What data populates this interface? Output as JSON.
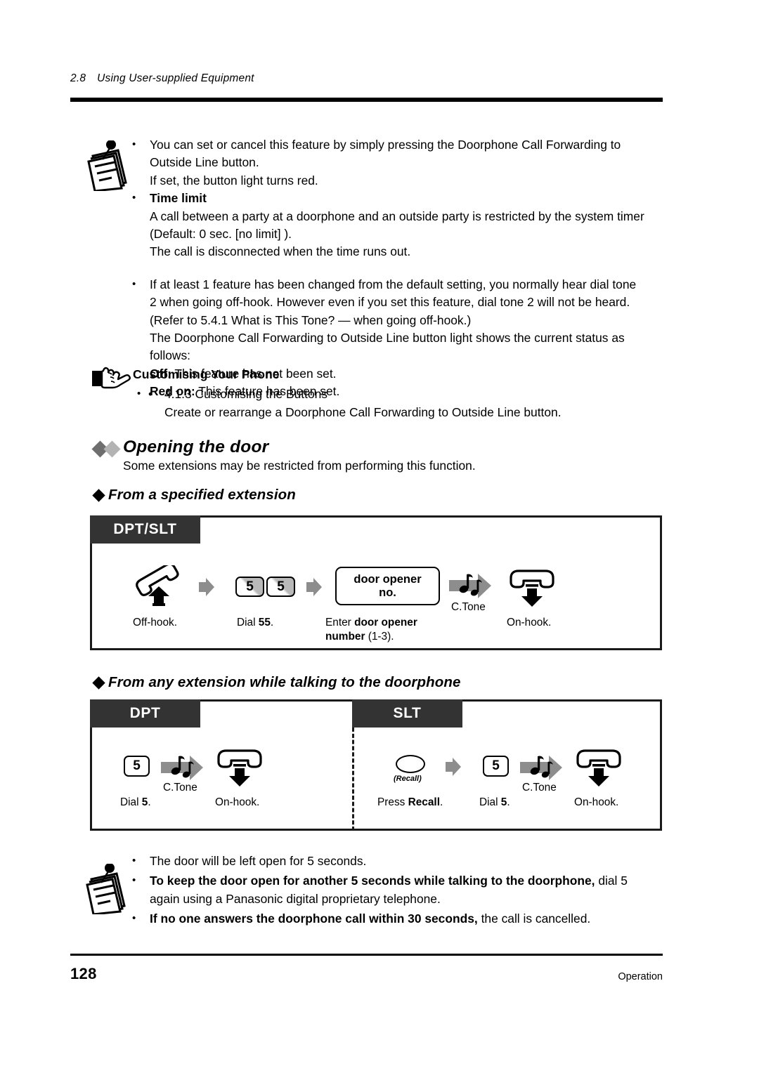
{
  "header": {
    "section_number": "2.8",
    "section_title": "Using User-supplied Equipment"
  },
  "note_block_top": {
    "icon": "note-pad-icon",
    "items": [
      {
        "bullet": true,
        "lines": [
          "You can set or cancel this feature by simply pressing the Doorphone Call Forwarding to",
          "Outside Line button.",
          "If set, the button light turns red."
        ]
      },
      {
        "bullet": true,
        "bold_lead": "Time limit",
        "lines": [
          "A call between a party at a doorphone and an outside party is restricted by the system timer",
          "(Default: 0 sec. [no limit] ).",
          "The call is disconnected when the time runs out."
        ]
      },
      {
        "bullet": true,
        "lines": [
          "If at least 1 feature has been changed from the default setting, you normally hear dial tone",
          "2 when going off-hook. However even if you set this feature, dial tone 2 will not be heard.",
          "(Refer to 5.4.1    What is This Tone? — when going off-hook.)",
          "The Doorphone Call Forwarding to Outside Line button light shows the current status as",
          "follows:"
        ],
        "status_lines": [
          {
            "bold": "Off:",
            "rest": " This feature has not been set."
          },
          {
            "bold": "Red on:",
            "rest": " This feature has been set."
          }
        ]
      }
    ]
  },
  "customising_block": {
    "icon": "pointing-hand-icon",
    "title": "Customising Your Phone",
    "items": [
      {
        "bullet": true,
        "text": "4.1.3    Customising the Buttons"
      },
      {
        "bullet": false,
        "text": "Create or rearrange a Doorphone Call Forwarding to Outside Line button."
      }
    ]
  },
  "opening_the_door": {
    "heading": "Opening the door",
    "diamond_color_1": "#6e6e6e",
    "diamond_color_2": "#b3b3b3",
    "intro": "Some extensions may be restricted from performing this function."
  },
  "subsection_1": {
    "heading": "From a specified extension",
    "diagram": {
      "tab_label": "DPT/SLT",
      "steps": [
        {
          "icon": "handset-off-hook-icon",
          "caption": "Off-hook."
        },
        {
          "icon": "arrow-right-icon"
        },
        {
          "keys": [
            "5",
            "5"
          ],
          "caption_prefix": "Dial ",
          "caption_bold": "55",
          "caption_suffix": "."
        },
        {
          "icon": "arrow-right-icon"
        },
        {
          "boxkey_line1": "door opener",
          "boxkey_line2": "no.",
          "caption_prefix": "Enter ",
          "caption_bold": "door opener",
          "caption_line2_bold": "number",
          "caption_line2_rest": " (1-3)."
        },
        {
          "icon": "tone-arrow-icon",
          "label": "C.Tone"
        },
        {
          "icon": "handset-on-hook-icon",
          "caption": "On-hook."
        }
      ]
    }
  },
  "subsection_2": {
    "heading": "From any extension while talking to the doorphone",
    "panels": [
      {
        "tab_label": "DPT",
        "steps": [
          {
            "key": "5",
            "caption_prefix": "Dial ",
            "caption_bold": "5",
            "caption_suffix": "."
          },
          {
            "icon": "tone-arrow-icon",
            "label": "C.Tone"
          },
          {
            "icon": "handset-on-hook-icon",
            "caption": "On-hook."
          }
        ]
      },
      {
        "tab_label": "SLT",
        "steps": [
          {
            "icon": "recall-key-icon",
            "key_label": "(Recall)",
            "caption_prefix": "Press ",
            "caption_bold": "Recall",
            "caption_suffix": "."
          },
          {
            "icon": "arrow-right-icon"
          },
          {
            "key": "5",
            "caption_prefix": "Dial ",
            "caption_bold": "5",
            "caption_suffix": "."
          },
          {
            "icon": "tone-arrow-icon",
            "label": "C.Tone"
          },
          {
            "icon": "handset-on-hook-icon",
            "caption": "On-hook."
          }
        ]
      }
    ]
  },
  "note_block_bottom": {
    "icon": "note-pad-icon",
    "items": [
      {
        "text": "The door will be left open for 5 seconds."
      },
      {
        "bold": "To keep the door open for another 5 seconds while talking to the doorphone,",
        "rest": " dial 5",
        "line2": "again using a Panasonic digital proprietary telephone."
      },
      {
        "bold": "If no one answers the doorphone call within 30 seconds,",
        "rest": " the call is cancelled."
      }
    ]
  },
  "footer": {
    "page_number": "128",
    "section": "Operation"
  }
}
